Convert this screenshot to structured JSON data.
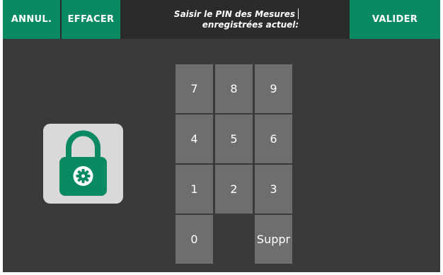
{
  "header": {
    "cancel_label": "ANNUL.",
    "clear_label": "EFFACER",
    "prompt_line1": "Saisir le PIN des Mesures",
    "prompt_line2": "enregistrées actuel:",
    "validate_label": "VALIDER"
  },
  "lock": {
    "icon": "lock-gear-icon"
  },
  "keypad": {
    "keys": [
      "7",
      "8",
      "9",
      "4",
      "5",
      "6",
      "1",
      "2",
      "3",
      "0",
      "Suppr"
    ]
  },
  "colors": {
    "accent": "#0a8a63",
    "background": "#3a3a3a",
    "key": "#6e6e6e",
    "lock_panel": "#d9d9d9"
  }
}
